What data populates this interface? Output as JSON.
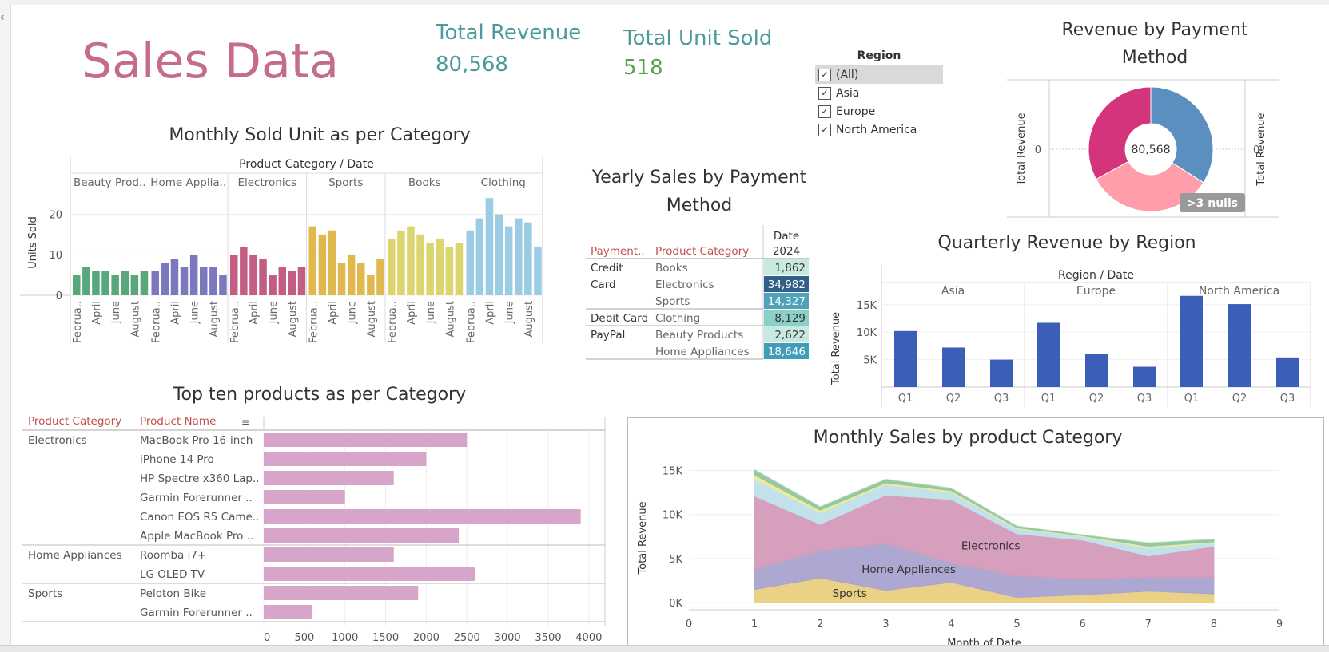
{
  "dashboard": {
    "title": "Sales Data",
    "kpis": [
      {
        "label": "Total Revenue",
        "value": "80,568",
        "color": "#4c9a9a"
      },
      {
        "label": "Total Unit Sold",
        "value": "518",
        "color": "#59a14f"
      }
    ]
  },
  "filter": {
    "title": "Region",
    "items": [
      {
        "label": "(All)",
        "checked": true,
        "selected": true
      },
      {
        "label": "Asia",
        "checked": true,
        "selected": false
      },
      {
        "label": "Europe",
        "checked": true,
        "selected": false
      },
      {
        "label": "North America",
        "checked": true,
        "selected": false
      }
    ]
  },
  "chart_data": [
    {
      "id": "monthly_units",
      "type": "bar",
      "title": "Monthly Sold Unit as per Category",
      "header": "Product Category / Date",
      "ylabel": "Units Sold",
      "ylim": [
        0,
        26
      ],
      "yticks": [
        0,
        10,
        20
      ],
      "month_labels": [
        "Februa..",
        "April",
        "June",
        "August"
      ],
      "panels": [
        {
          "name": "Beauty Prod..",
          "color": "#59a87b",
          "values": [
            5,
            7,
            6,
            6,
            5,
            6,
            5,
            6
          ]
        },
        {
          "name": "Home Applia..",
          "color": "#7b78bd",
          "values": [
            6,
            8,
            9,
            7,
            10,
            7,
            7,
            5
          ]
        },
        {
          "name": "Electronics",
          "color": "#c35d84",
          "values": [
            10,
            12,
            10,
            9,
            5,
            7,
            6,
            7
          ]
        },
        {
          "name": "Sports",
          "color": "#e0b84e",
          "values": [
            17,
            15,
            16,
            8,
            10,
            8,
            5,
            9
          ]
        },
        {
          "name": "Books",
          "color": "#dcd56e",
          "values": [
            14,
            16,
            17,
            15,
            13,
            14,
            12,
            13
          ]
        },
        {
          "name": "Clothing",
          "color": "#9acde4",
          "values": [
            16,
            19,
            24,
            20,
            17,
            19,
            18,
            12
          ]
        }
      ]
    },
    {
      "id": "yearly_payment",
      "type": "table",
      "title": "Yearly Sales by Payment Method",
      "col_headers": [
        "Payment..",
        "Product Category"
      ],
      "date_header": [
        "Date",
        "2024"
      ],
      "groups": [
        {
          "method": "Credit Card",
          "rows": [
            {
              "category": "Books",
              "value": "1,862",
              "bg": "#c8e9df",
              "fg": "#333"
            },
            {
              "category": "Electronics",
              "value": "34,982",
              "bg": "#2f5f8a",
              "fg": "#fff"
            },
            {
              "category": "Sports",
              "value": "14,327",
              "bg": "#4fa3b8",
              "fg": "#fff"
            }
          ]
        },
        {
          "method": "Debit Card",
          "rows": [
            {
              "category": "Clothing",
              "value": "8,129",
              "bg": "#8ccfc9",
              "fg": "#333"
            }
          ]
        },
        {
          "method": "PayPal",
          "rows": [
            {
              "category": "Beauty Products",
              "value": "2,622",
              "bg": "#c8e9df",
              "fg": "#333"
            },
            {
              "category": "Home Appliances",
              "value": "18,646",
              "bg": "#3f9db8",
              "fg": "#fff"
            }
          ]
        }
      ]
    },
    {
      "id": "payment_donut",
      "type": "pie",
      "title": "Revenue by Payment Method",
      "center_label": "80,568",
      "ylabel": "Total Revenue",
      "zero_label": "0",
      "null_badge": ">3 nulls",
      "slices": [
        {
          "value": 34,
          "color": "#5b8fc0"
        },
        {
          "value": 33,
          "color": "#ff9dab"
        },
        {
          "value": 33,
          "color": "#d4347c"
        }
      ]
    },
    {
      "id": "quarterly_region",
      "type": "bar",
      "title": "Quarterly Revenue by Region",
      "header": "Region / Date",
      "ylabel": "Total Revenue",
      "ylim": [
        0,
        17000
      ],
      "yticks": [
        {
          "v": 5000,
          "l": "5K"
        },
        {
          "v": 10000,
          "l": "10K"
        },
        {
          "v": 15000,
          "l": "15K"
        }
      ],
      "quarters": [
        "Q1",
        "Q2",
        "Q3"
      ],
      "color": "#3b5fb9",
      "panels": [
        {
          "name": "Asia",
          "values": [
            10200,
            7200,
            5000
          ]
        },
        {
          "name": "Europe",
          "values": [
            11700,
            6100,
            3700
          ]
        },
        {
          "name": "North America",
          "values": [
            16600,
            15100,
            5400
          ]
        }
      ]
    },
    {
      "id": "top_products",
      "type": "bar",
      "title": "Top ten products as per Category",
      "col_headers": [
        "Product Category",
        "Product Name"
      ],
      "xlim": [
        0,
        4100
      ],
      "xticks": [
        0,
        500,
        1000,
        1500,
        2000,
        2500,
        3000,
        3500,
        4000
      ],
      "color": "#d7a5ca",
      "groups": [
        {
          "category": "Electronics",
          "items": [
            {
              "name": "MacBook Pro 16-inch",
              "value": 2500
            },
            {
              "name": "iPhone 14 Pro",
              "value": 2000
            },
            {
              "name": "HP Spectre x360 Lap..",
              "value": 1600
            },
            {
              "name": "Garmin Forerunner ..",
              "value": 1000
            },
            {
              "name": "Canon EOS R5 Came..",
              "value": 3900
            },
            {
              "name": "Apple MacBook Pro ..",
              "value": 2400
            }
          ]
        },
        {
          "category": "Home Appliances",
          "items": [
            {
              "name": "Roomba i7+",
              "value": 1600
            },
            {
              "name": "LG OLED TV",
              "value": 2600
            }
          ]
        },
        {
          "category": "Sports",
          "items": [
            {
              "name": "Peloton Bike",
              "value": 1900
            },
            {
              "name": "Garmin Forerunner ..",
              "value": 600
            }
          ]
        }
      ]
    },
    {
      "id": "monthly_area",
      "type": "area",
      "title": "Monthly Sales by product Category",
      "ylabel": "Total Revenue",
      "xlabel": "Month of Date",
      "xlim": [
        0,
        9
      ],
      "ylim": [
        -800,
        15500
      ],
      "xticks": [
        0,
        1,
        2,
        3,
        4,
        5,
        6,
        7,
        8,
        9
      ],
      "yticks": [
        {
          "v": 0,
          "l": "0K"
        },
        {
          "v": 5000,
          "l": "5K"
        },
        {
          "v": 10000,
          "l": "10K"
        },
        {
          "v": 15000,
          "l": "15K"
        }
      ],
      "x": [
        1,
        2,
        3,
        4,
        5,
        6,
        7,
        8
      ],
      "series": [
        {
          "name": "Sports",
          "color": "#e9cf7e",
          "values": [
            1500,
            2800,
            1400,
            2300,
            600,
            900,
            1300,
            1000
          ]
        },
        {
          "name": "Home Appliances",
          "color": "#a8a3d0",
          "values": [
            2300,
            3100,
            5300,
            2200,
            2400,
            1800,
            1600,
            1900
          ]
        },
        {
          "name": "Electronics",
          "color": "#d59abb",
          "values": [
            8300,
            3000,
            5500,
            7200,
            4800,
            4400,
            2400,
            3500
          ]
        },
        {
          "name": "",
          "color": "#bfe0ea",
          "values": [
            1900,
            1300,
            1200,
            800,
            600,
            400,
            900,
            400
          ]
        },
        {
          "name": "",
          "color": "#ece99a",
          "values": [
            500,
            300,
            200,
            200,
            100,
            100,
            200,
            100
          ]
        },
        {
          "name": "",
          "color": "#8fc79b",
          "values": [
            600,
            400,
            400,
            300,
            200,
            100,
            400,
            300
          ]
        }
      ]
    }
  ]
}
